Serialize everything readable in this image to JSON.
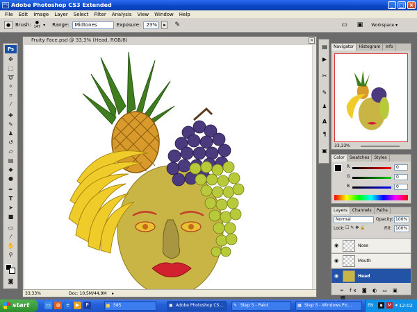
{
  "window": {
    "title": "Adobe Photoshop CS3 Extended",
    "minimize": "_",
    "maximize": "□",
    "close": "×"
  },
  "menu": [
    "File",
    "Edit",
    "Image",
    "Layer",
    "Select",
    "Filter",
    "Analysis",
    "View",
    "Window",
    "Help"
  ],
  "options": {
    "brush_label": "Brush:",
    "brush_size": "147",
    "range_label": "Range:",
    "range_value": "Midtones",
    "exposure_label": "Exposure:",
    "exposure_value": "23%",
    "workspace_label": "Workspace"
  },
  "tools": {
    "logo": "Ps"
  },
  "document": {
    "title": "Fruity Face.psd @ 33,3% (Head, RGB/8)",
    "zoom": "33,33%",
    "doc_info": "Doc: 10,5M/44,9M"
  },
  "navigator": {
    "tabs": [
      "Navigator",
      "Histogram",
      "Info"
    ],
    "zoom": "33,33%"
  },
  "color": {
    "tabs": [
      "Color",
      "Swatches",
      "Styles"
    ],
    "channels": [
      {
        "label": "R",
        "value": "0"
      },
      {
        "label": "G",
        "value": "0"
      },
      {
        "label": "B",
        "value": "0"
      }
    ]
  },
  "layers": {
    "tabs": [
      "Layers",
      "Channels",
      "Paths"
    ],
    "blend_mode": "Normal",
    "opacity_label": "Opacity:",
    "opacity_value": "100%",
    "lock_label": "Lock:",
    "fill_label": "Fill:",
    "fill_value": "100%",
    "items": [
      {
        "name": "Nose"
      },
      {
        "name": "Mouth"
      },
      {
        "name": "Head"
      }
    ]
  },
  "taskbar": {
    "start": "start",
    "tasks": [
      {
        "label": "585"
      },
      {
        "label": "Adobe Photoshop CS..."
      },
      {
        "label": "Step 5 - Paint"
      },
      {
        "label": "Step 5 - Windows Pic..."
      }
    ],
    "language": "EN",
    "time": "12:02"
  },
  "colors": {
    "title_bar": "#0a46c8",
    "selection": "#2353a7",
    "taskbar": "#2560d8",
    "start_button": "#2d8c2d"
  }
}
